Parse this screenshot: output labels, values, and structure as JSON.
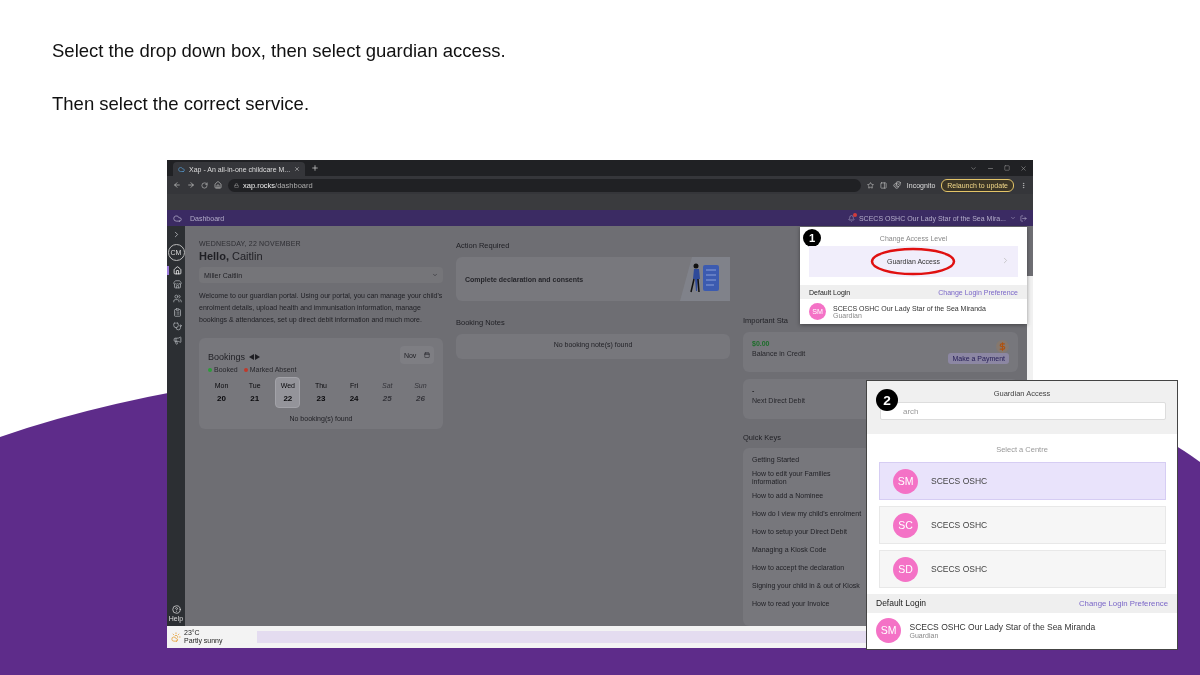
{
  "instructions": [
    "Select the drop down box, then select guardian access.",
    "Then select the correct service."
  ],
  "browser": {
    "tab_title": "Xap - An all-in-one childcare M...",
    "url_host": "xap.rocks",
    "url_path": "/dashboard",
    "profile": "Incognito",
    "update_button": "Relaunch to update"
  },
  "app_header": {
    "title": "Dashboard",
    "centre": "SCECS OSHC Our Lady Star of the Sea Mira..."
  },
  "sidebar": {
    "avatar": "CM",
    "items": [
      {
        "kind": "home",
        "selected": true
      },
      {
        "kind": "store",
        "selected": false
      },
      {
        "kind": "people",
        "selected": false
      },
      {
        "kind": "clipboard",
        "selected": false
      },
      {
        "kind": "stethoscope",
        "selected": false
      },
      {
        "kind": "megaphone",
        "selected": false
      }
    ],
    "help": "Help"
  },
  "greeting": {
    "date": "WEDNESDAY, 22 NOVEMBER",
    "hello": "**Hello,** Caitlin"
  },
  "child_select": {
    "value": "Miller Caitlin"
  },
  "welcome": "Welcome to our guardian portal. Using our portal, you can manage your child's enrolment details, upload health and immunisation information, manage bookings & attendances, set up direct debit information and much more.",
  "bookings": {
    "title": "Bookings",
    "legend": [
      {
        "label": "Booked",
        "color": "#2e9b3a"
      },
      {
        "label": "Marked Absent",
        "color": "#c0392b"
      }
    ],
    "month": "Nov",
    "days": [
      {
        "weekday": "Mon",
        "date": "20",
        "selected": false,
        "disabled": false
      },
      {
        "weekday": "Tue",
        "date": "21",
        "selected": false,
        "disabled": false
      },
      {
        "weekday": "Wed",
        "date": "22",
        "selected": true,
        "disabled": false
      },
      {
        "weekday": "Thu",
        "date": "23",
        "selected": false,
        "disabled": false
      },
      {
        "weekday": "Fri",
        "date": "24",
        "selected": false,
        "disabled": false
      },
      {
        "weekday": "Sat",
        "date": "25",
        "selected": false,
        "disabled": true
      },
      {
        "weekday": "Sun",
        "date": "26",
        "selected": false,
        "disabled": true
      }
    ],
    "empty": "No booking(s) found"
  },
  "action_required": {
    "title": "Action Required",
    "card": "Complete declaration and consents"
  },
  "booking_notes": {
    "title": "Booking Notes",
    "empty": "No booking note(s) found"
  },
  "important": {
    "title": "Important Sta",
    "credit": {
      "amount": "$0.00",
      "label": "Balance in Credit",
      "button": "Make a Payment"
    },
    "debit": {
      "amount": "-",
      "label": "Next Direct Debit"
    }
  },
  "quick_keys": {
    "title": "Quick Keys",
    "items": [
      "Getting Started",
      "How to edit your Families information",
      "How to add a Nominee",
      "How do I view my child's enrolment",
      "How to setup your Direct Debit",
      "Managing a Kiosk Code",
      "How to accept the declaration",
      "Signing your child in & out of Kiosk",
      "How to read your Invoice"
    ]
  },
  "taskbar": {
    "temperature": "23°C",
    "weather": "Partly sunny"
  },
  "popup_access": {
    "badge": "1",
    "title": "Change Access Level",
    "option": "Guardian Access",
    "default_login": {
      "label": "Default Login",
      "link": "Change Login Preference",
      "initials": "SM",
      "name": "SCECS OSHC Our Lady Star of the Sea Miranda",
      "role": "Guardian"
    }
  },
  "popup_centres": {
    "badge": "2",
    "title": "Guardian Access",
    "search": {
      "placeholder": "arch"
    },
    "subtitle": "Select a Centre",
    "centres": [
      {
        "initials": "SM",
        "name": "SCECS OSHC",
        "selected": true
      },
      {
        "initials": "SC",
        "name": "SCECS OSHC",
        "selected": false
      },
      {
        "initials": "SD",
        "name": "SCECS OSHC",
        "selected": false
      }
    ],
    "default_login": {
      "label": "Default Login",
      "link": "Change Login Preference",
      "initials": "SM",
      "name": "SCECS OSHC Our Lady Star of the Sea Miranda",
      "role": "Guardian"
    }
  }
}
